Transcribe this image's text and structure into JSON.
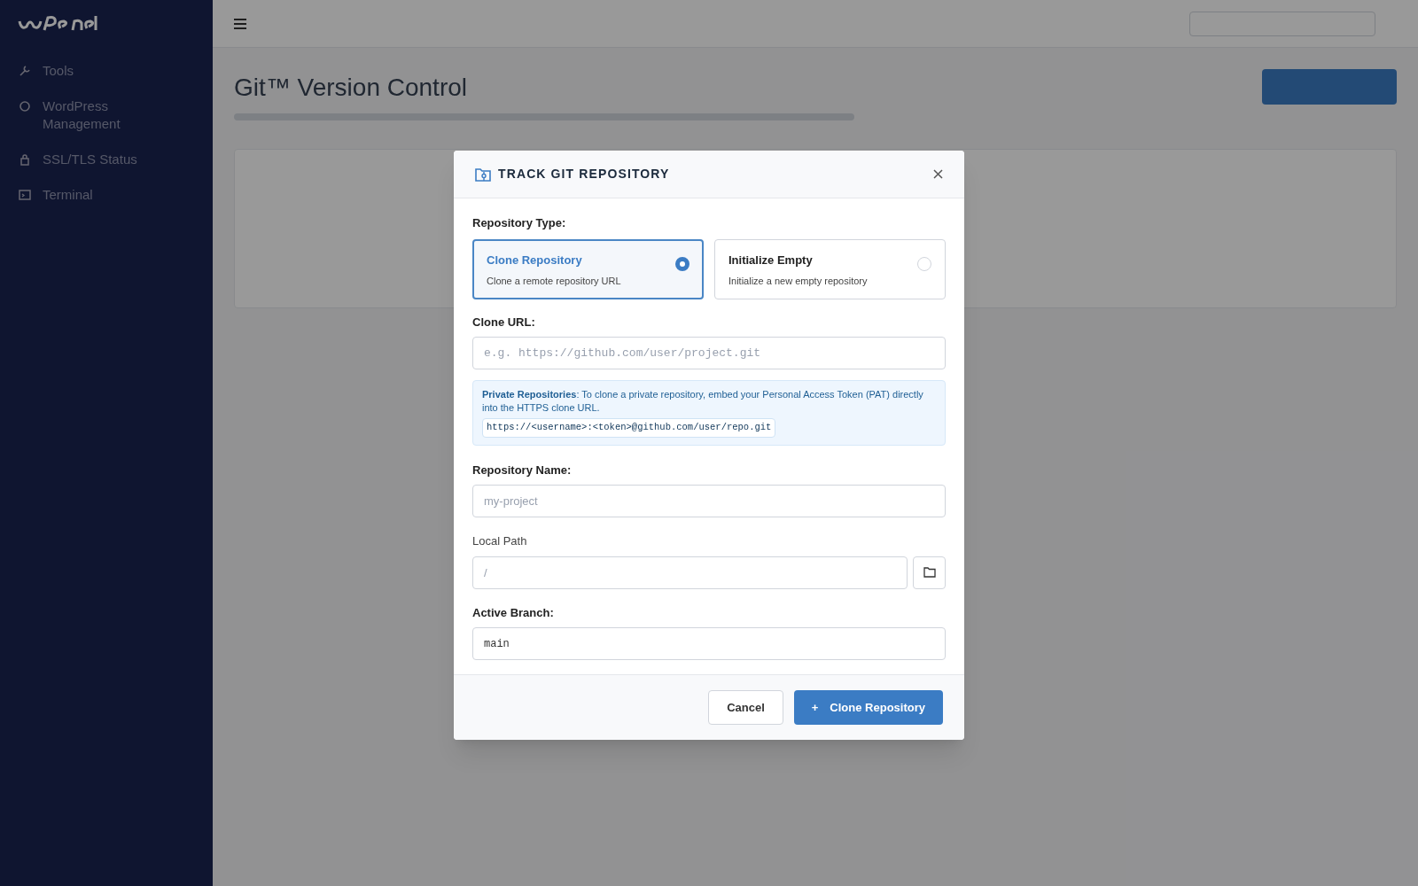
{
  "sidebar": {
    "items": [
      {
        "label": "Tools"
      },
      {
        "label": "WordPress Management"
      },
      {
        "label": "SSL/TLS Status"
      },
      {
        "label": "Terminal"
      }
    ]
  },
  "page": {
    "title": "Git™ Version Control"
  },
  "dialog": {
    "title": "TRACK GIT REPOSITORY",
    "repository_type": {
      "label": "Repository Type:",
      "options": [
        {
          "title": "Clone Repository",
          "description": "Clone a remote repository URL",
          "selected": true
        },
        {
          "title": "Initialize Empty",
          "description": "Initialize a new empty repository",
          "selected": false
        }
      ]
    },
    "clone_url": {
      "label": "Clone URL:",
      "placeholder": "e.g. https://github.com/user/project.git"
    },
    "info": {
      "text": "**Private Repositories**: To clone a private repository, embed your Personal Access Token (PAT) directly into the HTTPS clone URL.",
      "code": "https://<username>:<token>@github.com/user/repo.git"
    },
    "repository_name": {
      "label": "Repository Name:",
      "placeholder": "my-project"
    },
    "local_path": {
      "label": "Local Path",
      "placeholder": "/"
    },
    "active_branch": {
      "label": "Active Branch:",
      "value": "main"
    },
    "buttons": [
      {
        "kind": "secondary",
        "label": "Cancel"
      },
      {
        "kind": "primary",
        "icon_char": "+",
        "label": "Clone Repository"
      }
    ]
  }
}
